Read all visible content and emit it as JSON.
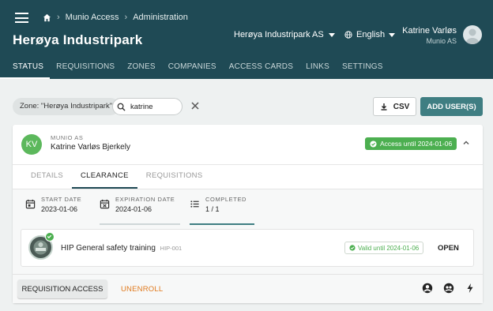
{
  "header": {
    "breadcrumb": [
      "Munio Access",
      "Administration"
    ],
    "title": "Herøya Industripark",
    "org_select": "Herøya Industripark AS",
    "language": "English",
    "user_name": "Katrine Varløs",
    "user_org": "Munio AS",
    "tabs": [
      "STATUS",
      "REQUISITIONS",
      "ZONES",
      "COMPANIES",
      "ACCESS CARDS",
      "LINKS",
      "SETTINGS"
    ],
    "active_tab": "STATUS"
  },
  "filters": {
    "zone_chip": "Zone: \"Herøya Industripark\"",
    "search_value": "katrine",
    "csv_label": "CSV",
    "add_user_label": "ADD USER(S)"
  },
  "card": {
    "initials": "KV",
    "org": "MUNIO AS",
    "name": "Katrine Varløs Bjerkely",
    "access_badge": "Access until 2024-01-06",
    "subtabs": [
      "DETAILS",
      "CLEARANCE",
      "REQUISITIONS"
    ],
    "active_subtab": "CLEARANCE",
    "stats": {
      "start_label": "START DATE",
      "start_value": "2023-01-06",
      "exp_label": "EXPIRATION DATE",
      "exp_value": "2024-01-06",
      "completed_label": "COMPLETED",
      "completed_value": "1 / 1"
    },
    "training": {
      "name": "HIP General safety training",
      "code": "HIP-001",
      "valid_badge": "Valid until 2024-01-06",
      "open_label": "OPEN"
    },
    "footer": {
      "requisition_label": "REQUISITION ACCESS",
      "unenroll_label": "UNENROLL"
    }
  },
  "colors": {
    "header_bg": "#1f4a55",
    "accent": "#3f7e82",
    "success": "#4caf50",
    "unenroll": "#e07a1e"
  }
}
